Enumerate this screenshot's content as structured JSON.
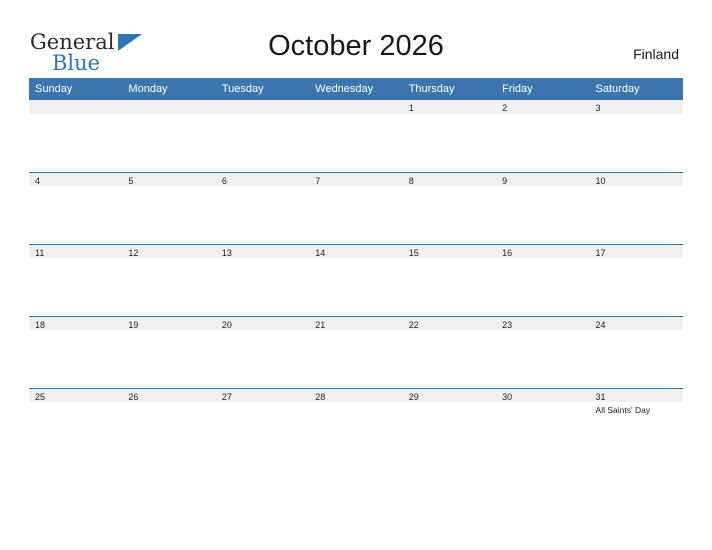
{
  "logo": {
    "word1": "General",
    "word2": "Blue",
    "flag_icon": "flag-triangle-icon"
  },
  "header": {
    "title": "October 2026",
    "country": "Finland"
  },
  "calendar": {
    "weekday_headers": [
      "Sunday",
      "Monday",
      "Tuesday",
      "Wednesday",
      "Thursday",
      "Friday",
      "Saturday"
    ],
    "weeks": [
      [
        {
          "day": "",
          "event": ""
        },
        {
          "day": "",
          "event": ""
        },
        {
          "day": "",
          "event": ""
        },
        {
          "day": "",
          "event": ""
        },
        {
          "day": "1",
          "event": ""
        },
        {
          "day": "2",
          "event": ""
        },
        {
          "day": "3",
          "event": ""
        }
      ],
      [
        {
          "day": "4",
          "event": ""
        },
        {
          "day": "5",
          "event": ""
        },
        {
          "day": "6",
          "event": ""
        },
        {
          "day": "7",
          "event": ""
        },
        {
          "day": "8",
          "event": ""
        },
        {
          "day": "9",
          "event": ""
        },
        {
          "day": "10",
          "event": ""
        }
      ],
      [
        {
          "day": "11",
          "event": ""
        },
        {
          "day": "12",
          "event": ""
        },
        {
          "day": "13",
          "event": ""
        },
        {
          "day": "14",
          "event": ""
        },
        {
          "day": "15",
          "event": ""
        },
        {
          "day": "16",
          "event": ""
        },
        {
          "day": "17",
          "event": ""
        }
      ],
      [
        {
          "day": "18",
          "event": ""
        },
        {
          "day": "19",
          "event": ""
        },
        {
          "day": "20",
          "event": ""
        },
        {
          "day": "21",
          "event": ""
        },
        {
          "day": "22",
          "event": ""
        },
        {
          "day": "23",
          "event": ""
        },
        {
          "day": "24",
          "event": ""
        }
      ],
      [
        {
          "day": "25",
          "event": ""
        },
        {
          "day": "26",
          "event": ""
        },
        {
          "day": "27",
          "event": ""
        },
        {
          "day": "28",
          "event": ""
        },
        {
          "day": "29",
          "event": ""
        },
        {
          "day": "30",
          "event": ""
        },
        {
          "day": "31",
          "event": "All Saints' Day"
        }
      ]
    ]
  },
  "colors": {
    "header_blue": "#3a75ad",
    "logo_blue": "#2e75b6",
    "day_bar": "#f0f0f0"
  }
}
